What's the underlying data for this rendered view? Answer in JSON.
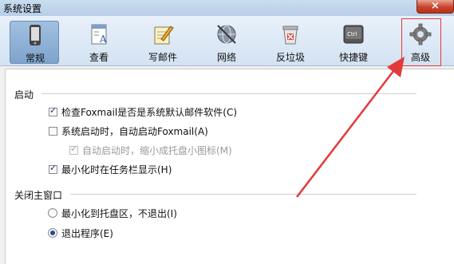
{
  "window": {
    "title": "系统设置",
    "close_symbol": "×"
  },
  "toolbar": {
    "tabs": [
      {
        "label": "常规",
        "icon": "phone-icon"
      },
      {
        "label": "查看",
        "icon": "document-view-icon"
      },
      {
        "label": "写邮件",
        "icon": "pencil-notepad-icon"
      },
      {
        "label": "网络",
        "icon": "globe-network-icon"
      },
      {
        "label": "反垃圾",
        "icon": "trash-block-icon"
      },
      {
        "label": "快捷键",
        "icon": "ctrl-key-icon",
        "key_text": "Ctrl"
      },
      {
        "label": "高级",
        "icon": "gear-icon"
      }
    ],
    "active_tab": "常规",
    "highlighted_tab": "高级"
  },
  "startup": {
    "title": "启动",
    "options": [
      {
        "label": "检查Foxmail是否是系统默认邮件软件(C)",
        "checked": true,
        "enabled": true
      },
      {
        "label": "系统启动时，自动启动Foxmail(A)",
        "checked": false,
        "enabled": true
      },
      {
        "label": "自动启动时，缩小成托盘小图标(M)",
        "checked": true,
        "enabled": false
      },
      {
        "label": "最小化时在任务栏显示(H)",
        "checked": true,
        "enabled": true
      }
    ]
  },
  "close_main_window": {
    "title": "关闭主窗口",
    "options": [
      {
        "label": "最小化到托盘区，不退出(I)",
        "selected": false
      },
      {
        "label": "退出程序(E)",
        "selected": true
      }
    ]
  },
  "colors": {
    "annotation": "#e23a3a",
    "active_tab": "#8fb1d6"
  }
}
